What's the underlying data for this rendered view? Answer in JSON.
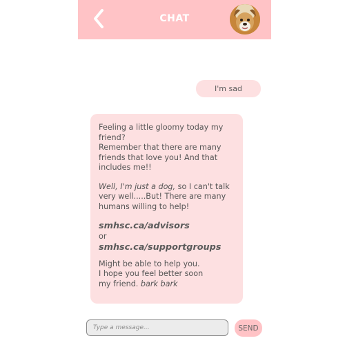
{
  "header": {
    "back_icon": "chevron-left-icon",
    "title": "CHAT",
    "avatar_icon": "dog-avatar-icon"
  },
  "messages": {
    "user": "I'm sad",
    "bot": {
      "line1": "Feeling a little gloomy today my friend?",
      "line2": "Remember that there are many friends that love you! And that includes me!!",
      "para2_italic": "Well, I'm just a dog,",
      "para2_rest": " so I can't talk very well.....But! There are many humans willing to help!",
      "link1": "smhsc.ca/advisors",
      "or": "or",
      "link2": "smhsc.ca/supportgroups",
      "closing1": "Might be able to help you.",
      "closing2": "I hope you feel better soon",
      "closing3_plain": "my friend. ",
      "closing3_italic": "bark bark"
    }
  },
  "composer": {
    "placeholder": "Type a message...",
    "send_label": "SEND"
  },
  "colors": {
    "header_bg": "#ffc3c6",
    "bubble_bg": "#fde0e1"
  }
}
